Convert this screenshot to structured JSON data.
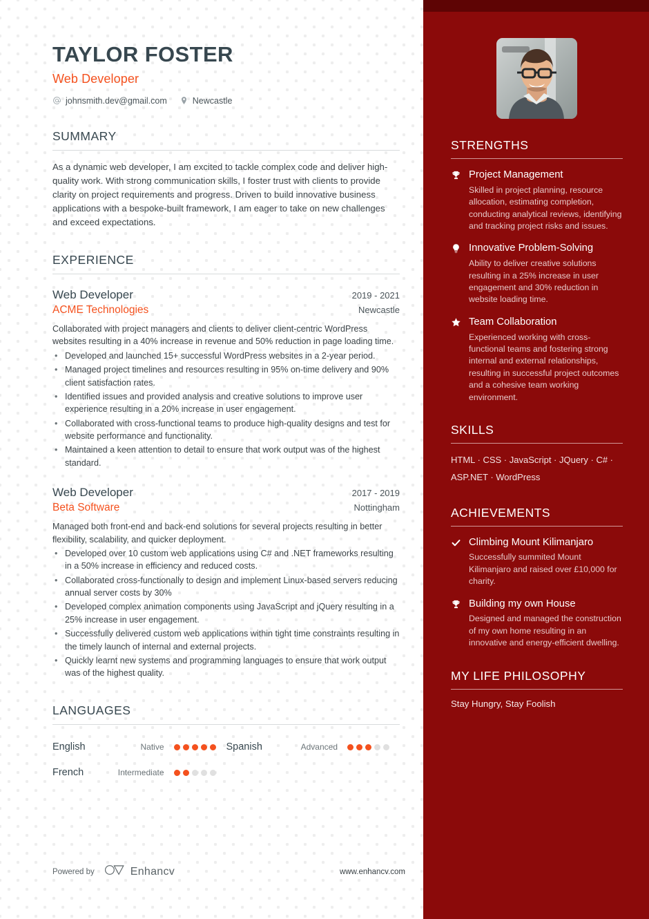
{
  "header": {
    "name": "TAYLOR FOSTER",
    "job_title": "Web Developer",
    "email": "johnsmith.dev@gmail.com",
    "location": "Newcastle",
    "email_icon": "at-icon",
    "location_icon": "map-pin-icon"
  },
  "summary": {
    "title": "SUMMARY",
    "text": "As a dynamic web developer, I am excited to tackle complex code and deliver high-quality work. With strong communication skills, I foster trust with clients to provide clarity on project requirements and progress. Driven to build innovative business applications with a bespoke-built framework, I am eager to take on new challenges and exceed expectations."
  },
  "experience": {
    "title": "EXPERIENCE",
    "jobs": [
      {
        "role": "Web Developer",
        "date": "2019 - 2021",
        "company": "ACME Technologies",
        "location": "Newcastle",
        "description": "Collaborated with project managers and clients to deliver client-centric WordPress websites resulting in a 40% increase in revenue and 50% reduction in page loading time.",
        "bullets": [
          "Developed and launched 15+ successful WordPress websites in a 2-year period.",
          "Managed project timelines and resources resulting in 95% on-time delivery and 90% client satisfaction rates.",
          "Identified issues and provided analysis and creative solutions to improve user experience resulting in a 20% increase in user engagement.",
          "Collaborated with cross-functional teams to produce high-quality designs and test for website performance and functionality.",
          "Maintained a keen attention to detail to ensure that work output was of the highest standard."
        ]
      },
      {
        "role": "Web Developer",
        "date": "2017 - 2019",
        "company": "Beta Software",
        "location": "Nottingham",
        "description": "Managed both front-end and back-end solutions for several projects resulting in better flexibility, scalability, and quicker deployment.",
        "bullets": [
          "Developed over 10 custom web applications using C# and .NET frameworks resulting in a 50% increase in efficiency and reduced costs.",
          "Collaborated cross-functionally to design and implement Linux-based servers reducing annual server costs by 30%",
          "Developed complex animation components using JavaScript and jQuery resulting in a 25% increase in user engagement.",
          "Successfully delivered custom web applications within tight time constraints resulting in the timely launch of internal and external projects.",
          "Quickly learnt new systems and programming languages to ensure that work output was of the highest quality."
        ]
      }
    ]
  },
  "languages": {
    "title": "LANGUAGES",
    "max_rating": 5,
    "items": [
      {
        "name": "English",
        "level": "Native",
        "rating": 5
      },
      {
        "name": "Spanish",
        "level": "Advanced",
        "rating": 3
      },
      {
        "name": "French",
        "level": "Intermediate",
        "rating": 2
      }
    ]
  },
  "strengths": {
    "title": "STRENGTHS",
    "items": [
      {
        "icon": "trophy-icon",
        "title": "Project Management",
        "desc": "Skilled in project planning, resource allocation, estimating completion, conducting analytical reviews, identifying and tracking project risks and issues."
      },
      {
        "icon": "lightbulb-icon",
        "title": "Innovative Problem-Solving",
        "desc": "Ability to deliver creative solutions resulting in a 25% increase in user engagement and 30% reduction in website loading time."
      },
      {
        "icon": "star-icon",
        "title": "Team Collaboration",
        "desc": "Experienced working with cross-functional teams and fostering strong internal and external relationships, resulting in successful project outcomes and a cohesive team working environment."
      }
    ]
  },
  "skills": {
    "title": "SKILLS",
    "list": "HTML · CSS · JavaScript · JQuery · C# · ASP.NET · WordPress"
  },
  "achievements": {
    "title": "ACHIEVEMENTS",
    "items": [
      {
        "icon": "check-icon",
        "title": "Climbing Mount Kilimanjaro",
        "desc": "Successfully summited Mount Kilimanjaro and raised over £10,000 for charity."
      },
      {
        "icon": "trophy-icon",
        "title": "Building my own House",
        "desc": "Designed and managed the construction of my own home resulting in an innovative and energy-efficient dwelling."
      }
    ]
  },
  "philosophy": {
    "title": "MY LIFE PHILOSOPHY",
    "text": "Stay Hungry, Stay Foolish"
  },
  "footer": {
    "powered_by": "Powered by",
    "brand": "Enhancv",
    "website": "www.enhancv.com",
    "brand_icon": "enhancv-logo-icon"
  },
  "colors": {
    "accent_orange": "#f4511e",
    "sidebar_red": "#8b0a0a",
    "sidebar_band": "#5e0404",
    "heading_dark": "#37474f"
  }
}
